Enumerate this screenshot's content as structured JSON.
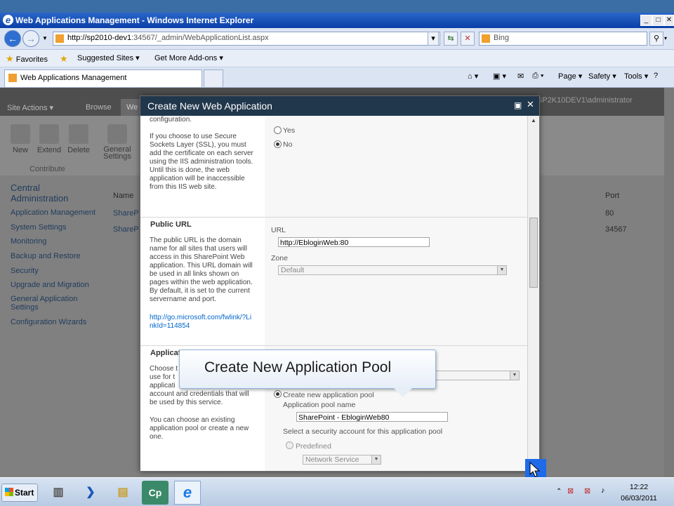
{
  "browser": {
    "window_title": "Web Applications Management - Windows Internet Explorer",
    "url_host": "http://sp2010-dev1",
    "url_path": ":34567/_admin/WebApplicationList.aspx",
    "search_placeholder": "Bing",
    "favorites_label": "Favorites",
    "suggested_sites_label": "Suggested Sites",
    "get_more_addons_label": "Get More Add-ons",
    "tab_label": "Web Applications Management",
    "cmd_page": "Page",
    "cmd_safety": "Safety",
    "cmd_tools": "Tools"
  },
  "sharepoint": {
    "site_actions": "Site Actions",
    "browse_tab": "Browse",
    "web_tab": "We",
    "user": "SP2K10DEV1\\administrator",
    "ribbon": [
      "New",
      "Extend",
      "Delete",
      "General Settings"
    ],
    "contribute": "Contribute",
    "nav_heading": "Central Administration",
    "nav_items": [
      "Application Management",
      "System Settings",
      "Monitoring",
      "Backup and Restore",
      "Security",
      "Upgrade and Migration",
      "General Application Settings",
      "Configuration Wizards"
    ],
    "col_name": "Name",
    "col_port": "Port",
    "rows": [
      {
        "name": "ShareP",
        "port": "80"
      },
      {
        "name": "ShareP",
        "port": "34567"
      }
    ]
  },
  "dialog": {
    "title": "Create New Web Application",
    "ssl_desc_top": "configuration.",
    "ssl_desc": "If you choose to use Secure Sockets Layer (SSL), you must add the certificate on each server using the IIS administration tools.  Until this is done, the web application will be inaccessible from this IIS web site.",
    "ssl_yes": "Yes",
    "ssl_no": "No",
    "public_url_title": "Public URL",
    "public_url_desc": "The public URL is the domain name for all sites that users will access in this SharePoint Web application. This URL domain will be used in all links shown on pages within the web application.  By default, it is set to the current servername and port.",
    "public_url_link": "http://go.microsoft.com/fwlink/?LinkId=114854",
    "url_label": "URL",
    "url_value": "http://EbloginWeb:80",
    "zone_label": "Zone",
    "zone_value": "Default",
    "app_pool_title": "Applicat",
    "app_pool_desc1": "Choose t",
    "app_pool_desc2": "use for t",
    "app_pool_desc3": "applicati",
    "app_pool_desc4": "account and credentials that will be used by this service.",
    "app_pool_desc5": "You can choose an existing application pool or create a new one.",
    "create_new_pool": "Create new application pool",
    "pool_name_label": "Application pool name",
    "pool_name_value": "SharePoint - EbloginWeb80",
    "security_account_label": "Select a security account for this application pool",
    "predefined_label": "Predefined",
    "predefined_value": "Network Service"
  },
  "callout": {
    "text": "Create New Application Pool"
  },
  "taskbar": {
    "start": "Start",
    "clock_time": "12:22",
    "clock_date": "06/03/2011"
  }
}
